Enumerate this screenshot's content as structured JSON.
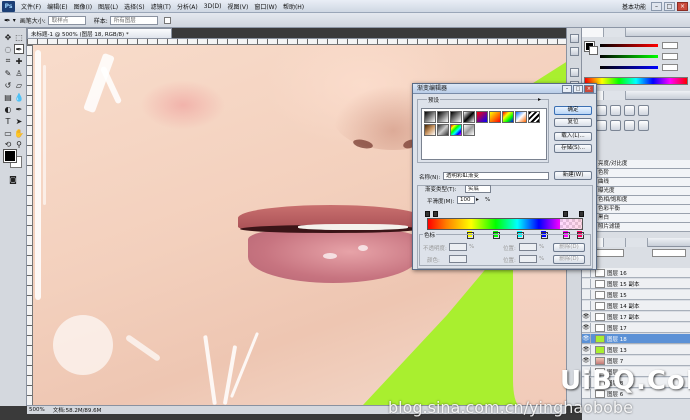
{
  "menubar": {
    "logo": "Ps",
    "items": [
      "文件(F)",
      "编辑(E)",
      "图像(I)",
      "图层(L)",
      "选择(S)",
      "滤镜(T)",
      "分析(A)",
      "3D(D)",
      "视图(V)",
      "窗口(W)",
      "帮助(H)"
    ],
    "workspace": "基本功能"
  },
  "options": {
    "brush_size_label": "画笔大小:",
    "brush_size_value": "取样点",
    "sample_label": "样本:",
    "sample_value": "所有图层"
  },
  "document": {
    "tab_title": "未标题-1 @ 500% (图层 18, RGB/8) *",
    "zoom": "500%",
    "doc_info": "文档:58.2M/89.6M"
  },
  "layers": {
    "rows": [
      {
        "name": "图层 16",
        "visible": false,
        "active": false,
        "thumb": "white"
      },
      {
        "name": "图层 15 副本",
        "visible": false,
        "active": false,
        "thumb": "white"
      },
      {
        "name": "图层 15",
        "visible": false,
        "active": false,
        "thumb": "white"
      },
      {
        "name": "图层 14 副本",
        "visible": false,
        "active": false,
        "thumb": "white"
      },
      {
        "name": "图层 17 副本",
        "visible": true,
        "active": false,
        "thumb": "white"
      },
      {
        "name": "图层 17",
        "visible": true,
        "active": false,
        "thumb": "white"
      },
      {
        "name": "图层 18",
        "visible": true,
        "active": true,
        "thumb": "green"
      },
      {
        "name": "图层 13",
        "visible": true,
        "active": false,
        "thumb": "green"
      },
      {
        "name": "图层 7",
        "visible": true,
        "active": false,
        "thumb": "photo"
      },
      {
        "name": "图层 9",
        "visible": false,
        "active": false,
        "thumb": "white"
      },
      {
        "name": "图层 8",
        "visible": false,
        "active": false,
        "thumb": "white"
      },
      {
        "name": "图层 6",
        "visible": false,
        "active": false,
        "thumb": "white"
      }
    ]
  },
  "styles_presets": {
    "rows": [
      "亮度/对比度",
      "色阶",
      "曲线",
      "曝光度",
      "色相/饱和度",
      "色彩平衡",
      "黑白",
      "照片滤镜"
    ]
  },
  "dialog": {
    "title": "渐变编辑器",
    "presets_label": "预设",
    "ok": "确定",
    "reset": "复位",
    "load": "载入(L)...",
    "save": "存储(S)...",
    "name_label": "名称(N):",
    "name_value": "透明彩虹渐变",
    "new_button": "新建(W)",
    "gradient_type_label": "渐变类型(T):",
    "gradient_type_value": "实底",
    "smoothness_label": "平滑度(M):",
    "smoothness_value": "100",
    "percent": "%",
    "stops_label": "色标",
    "opacity_label": "不透明度:",
    "location_label": "位置:",
    "delete_label": "删除(D)",
    "color_label": "颜色:"
  },
  "watermark": {
    "url": "blog.sina.com.cn/yinghaobobe",
    "brand": "UiBQ.CoM"
  },
  "colors": {
    "canvas_green": "#a9ef2f",
    "active_layer": "#5b91d6"
  }
}
